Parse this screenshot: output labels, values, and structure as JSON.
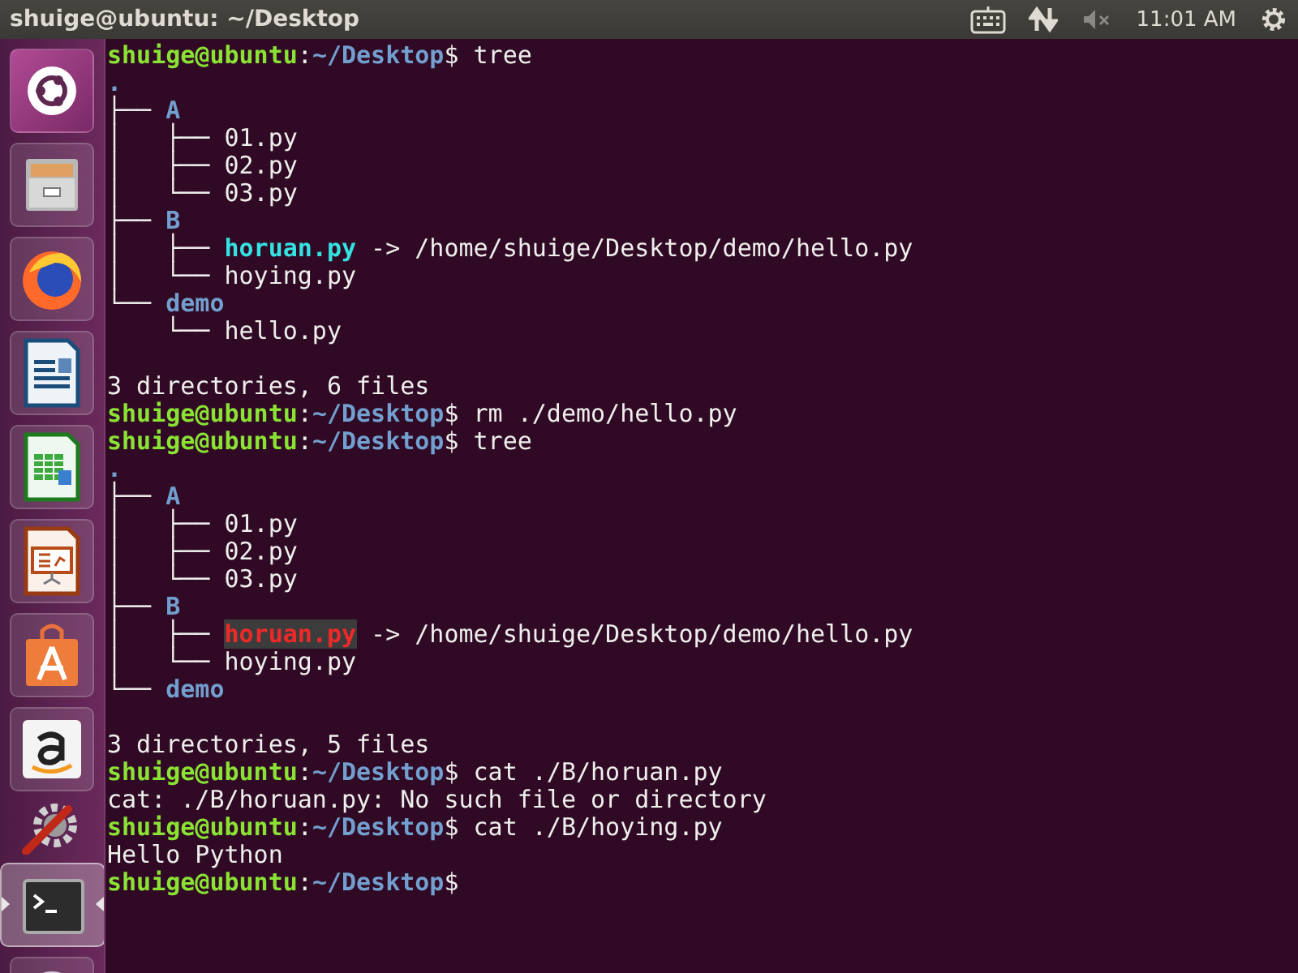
{
  "top_bar": {
    "title": "shuige@ubuntu: ~/Desktop",
    "sound": {
      "muted": true
    },
    "time": "11:01 AM"
  },
  "launcher": [
    {
      "kind": "dash",
      "active": false
    },
    {
      "kind": "files",
      "active": false
    },
    {
      "kind": "firefox",
      "active": false
    },
    {
      "kind": "writer",
      "active": false
    },
    {
      "kind": "calc",
      "active": false
    },
    {
      "kind": "impress",
      "active": false
    },
    {
      "kind": "software",
      "active": false
    },
    {
      "kind": "amazon",
      "active": false
    },
    {
      "kind": "settings",
      "active": false
    },
    {
      "kind": "terminal",
      "active": true
    },
    {
      "kind": "disc",
      "active": false
    }
  ],
  "terminal": {
    "lines": [
      {
        "kind": "text",
        "segments": [
          {
            "text": "shuige@ubuntu",
            "kind": "user"
          },
          {
            "text": ":",
            "kind": "plain"
          },
          {
            "text": "~/Desktop",
            "kind": "path"
          },
          {
            "text": "$ tree",
            "kind": "plain"
          }
        ]
      },
      {
        "kind": "text",
        "segments": [
          {
            "text": ".",
            "kind": "dir"
          }
        ]
      },
      {
        "kind": "text",
        "segments": [
          {
            "text": "├── ",
            "kind": "plain"
          },
          {
            "text": "A",
            "kind": "dir"
          }
        ]
      },
      {
        "kind": "text",
        "segments": [
          {
            "text": "│   ├── 01.py",
            "kind": "plain"
          }
        ]
      },
      {
        "kind": "text",
        "segments": [
          {
            "text": "│   ├── 02.py",
            "kind": "plain"
          }
        ]
      },
      {
        "kind": "text",
        "segments": [
          {
            "text": "│   └── 03.py",
            "kind": "plain"
          }
        ]
      },
      {
        "kind": "text",
        "segments": [
          {
            "text": "├── ",
            "kind": "plain"
          },
          {
            "text": "B",
            "kind": "dir"
          }
        ]
      },
      {
        "kind": "text",
        "segments": [
          {
            "text": "│   ├── ",
            "kind": "plain"
          },
          {
            "text": "horuan.py",
            "kind": "link"
          },
          {
            "text": " -> /home/shuige/Desktop/demo/hello.py",
            "kind": "plain"
          }
        ]
      },
      {
        "kind": "text",
        "segments": [
          {
            "text": "│   └── hoying.py",
            "kind": "plain"
          }
        ]
      },
      {
        "kind": "text",
        "segments": [
          {
            "text": "└── ",
            "kind": "plain"
          },
          {
            "text": "demo",
            "kind": "dir"
          }
        ]
      },
      {
        "kind": "text",
        "segments": [
          {
            "text": "    └── hello.py",
            "kind": "plain"
          }
        ]
      },
      {
        "kind": "blank"
      },
      {
        "kind": "text",
        "segments": [
          {
            "text": "3 directories, 6 files",
            "kind": "plain"
          }
        ]
      },
      {
        "kind": "text",
        "segments": [
          {
            "text": "shuige@ubuntu",
            "kind": "user"
          },
          {
            "text": ":",
            "kind": "plain"
          },
          {
            "text": "~/Desktop",
            "kind": "path"
          },
          {
            "text": "$ rm ./demo/hello.py",
            "kind": "plain"
          }
        ]
      },
      {
        "kind": "text",
        "segments": [
          {
            "text": "shuige@ubuntu",
            "kind": "user"
          },
          {
            "text": ":",
            "kind": "plain"
          },
          {
            "text": "~/Desktop",
            "kind": "path"
          },
          {
            "text": "$ tree",
            "kind": "plain"
          }
        ]
      },
      {
        "kind": "text",
        "segments": [
          {
            "text": ".",
            "kind": "dir"
          }
        ]
      },
      {
        "kind": "text",
        "segments": [
          {
            "text": "├── ",
            "kind": "plain"
          },
          {
            "text": "A",
            "kind": "dir"
          }
        ]
      },
      {
        "kind": "text",
        "segments": [
          {
            "text": "│   ├── 01.py",
            "kind": "plain"
          }
        ]
      },
      {
        "kind": "text",
        "segments": [
          {
            "text": "│   ├── 02.py",
            "kind": "plain"
          }
        ]
      },
      {
        "kind": "text",
        "segments": [
          {
            "text": "│   └── 03.py",
            "kind": "plain"
          }
        ]
      },
      {
        "kind": "text",
        "segments": [
          {
            "text": "├── ",
            "kind": "plain"
          },
          {
            "text": "B",
            "kind": "dir"
          }
        ]
      },
      {
        "kind": "text",
        "segments": [
          {
            "text": "│   ├── ",
            "kind": "plain"
          },
          {
            "text": "horuan.py",
            "kind": "broken"
          },
          {
            "text": " -> /home/shuige/Desktop/demo/hello.py",
            "kind": "plain"
          }
        ]
      },
      {
        "kind": "text",
        "segments": [
          {
            "text": "│   └── hoying.py",
            "kind": "plain"
          }
        ]
      },
      {
        "kind": "text",
        "segments": [
          {
            "text": "└── ",
            "kind": "plain"
          },
          {
            "text": "demo",
            "kind": "dir"
          }
        ]
      },
      {
        "kind": "blank"
      },
      {
        "kind": "text",
        "segments": [
          {
            "text": "3 directories, 5 files",
            "kind": "plain"
          }
        ]
      },
      {
        "kind": "text",
        "segments": [
          {
            "text": "shuige@ubuntu",
            "kind": "user"
          },
          {
            "text": ":",
            "kind": "plain"
          },
          {
            "text": "~/Desktop",
            "kind": "path"
          },
          {
            "text": "$ cat ./B/horuan.py",
            "kind": "plain"
          }
        ]
      },
      {
        "kind": "text",
        "segments": [
          {
            "text": "cat: ./B/horuan.py: No such file or directory",
            "kind": "plain"
          }
        ]
      },
      {
        "kind": "text",
        "segments": [
          {
            "text": "shuige@ubuntu",
            "kind": "user"
          },
          {
            "text": ":",
            "kind": "plain"
          },
          {
            "text": "~/Desktop",
            "kind": "path"
          },
          {
            "text": "$ cat ./B/hoying.py",
            "kind": "plain"
          }
        ]
      },
      {
        "kind": "text",
        "segments": [
          {
            "text": "Hello Python",
            "kind": "plain"
          }
        ]
      },
      {
        "kind": "text",
        "segments": [
          {
            "text": "shuige@ubuntu",
            "kind": "user"
          },
          {
            "text": ":",
            "kind": "plain"
          },
          {
            "text": "~/Desktop",
            "kind": "path"
          },
          {
            "text": "$",
            "kind": "plain"
          }
        ]
      }
    ]
  }
}
